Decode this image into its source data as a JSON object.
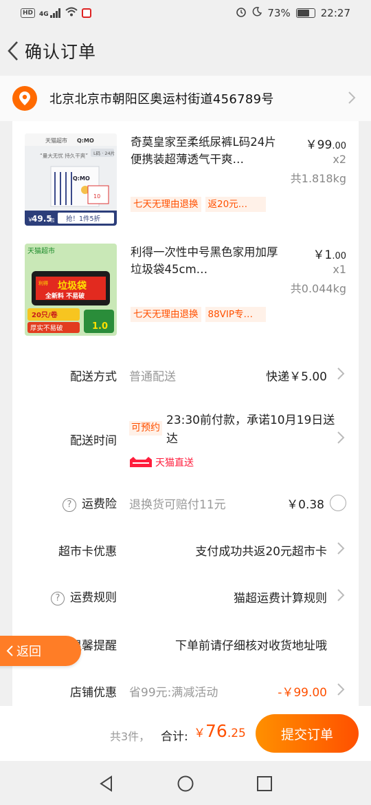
{
  "status_bar": {
    "network_badge": "HD",
    "signal": "4G",
    "battery_percent": "73%",
    "time": "22:27"
  },
  "header": {
    "title": "确认订单"
  },
  "address": {
    "text": "北京北京市朝阳区奥运村街道456789号"
  },
  "products": [
    {
      "title": "奇莫皇家至柔纸尿裤L码24片便携装超薄透气干爽…",
      "price_symbol": "￥",
      "price_int": "99",
      "price_dec": ".00",
      "qty": "x2",
      "weight": "共1.818kg",
      "tags": [
        "七天无理由退换",
        "返20元…"
      ],
      "image": {
        "store": "天猫超市",
        "brand": "Q:MO",
        "size": "L码 · 24片",
        "slogan": "“量大无忧 持久干爽”",
        "box_brand": "Q:MO",
        "box_sticker": "10",
        "price_tag_prefix": "￥",
        "price_tag": "49.5",
        "price_tag_unit": "/包",
        "promo": "抢！1件5折"
      }
    },
    {
      "title": "利得一次性中号黑色家用加厚垃圾袋45cm…",
      "price_symbol": "￥",
      "price_int": "1",
      "price_dec": ".00",
      "qty": "x1",
      "weight": "共0.044kg",
      "tags": [
        "七天无理由退换",
        "88VIP专…"
      ],
      "image": {
        "store": "天猫超市",
        "bag_brand": "利得",
        "bag_title": "垃圾袋",
        "bag_sub": "全新料  不易破",
        "count": "20只/卷",
        "feature": "厚实不易破",
        "price_tag": "1.0"
      }
    }
  ],
  "rows": {
    "delivery_method": {
      "label": "配送方式",
      "sub": "普通配送",
      "value": "快递￥5.00"
    },
    "delivery_time": {
      "label": "配送时间",
      "badge": "可预约",
      "text": "23:30前付款，承诺10月19日送达",
      "service": "天猫直送"
    },
    "shipping_insurance": {
      "help": "?",
      "label": "运费险",
      "sub": "退换货可赔付11元",
      "value": "￥0.38"
    },
    "market_card": {
      "label": "超市卡优惠",
      "value": "支付成功共返20元超市卡"
    },
    "shipping_rules": {
      "help": "?",
      "label": "运费规则",
      "value": "猫超运费计算规则"
    },
    "reminder": {
      "label": "温馨提醒",
      "value": "下单前请仔细核对收货地址哦"
    },
    "store_discount": {
      "label": "店铺优惠",
      "sub": "省99元:满减活动",
      "value": "-￥99.00"
    }
  },
  "float_back": {
    "label": "返回"
  },
  "bottom_bar": {
    "count": "共3件，",
    "total_label": "合计:",
    "currency": "￥",
    "amount_int": "76",
    "amount_dec": ".25",
    "submit": "提交订单"
  },
  "colors": {
    "accent": "#ff5000",
    "accent_light": "#ff9000",
    "tag_bg": "#fff1e8",
    "tmall_red": "#ff1d3c"
  }
}
